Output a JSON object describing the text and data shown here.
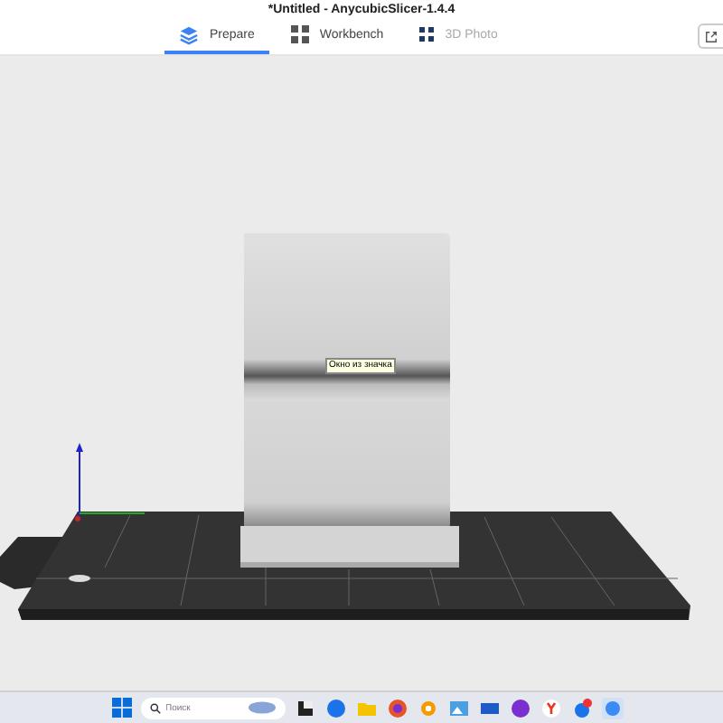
{
  "window": {
    "title": "*Untitled - AnycubicSlicer-1.4.4"
  },
  "tabs": [
    {
      "label": "Prepare",
      "kind": "layers",
      "selected": true,
      "disabled": false
    },
    {
      "label": "Workbench",
      "kind": "grid",
      "selected": false,
      "disabled": false
    },
    {
      "label": "3D Photo",
      "kind": "dots",
      "selected": false,
      "disabled": true
    }
  ],
  "tooltip": {
    "text": "Окно из значка"
  },
  "taskbar": {
    "search": {
      "placeholder": "Поиск"
    }
  }
}
